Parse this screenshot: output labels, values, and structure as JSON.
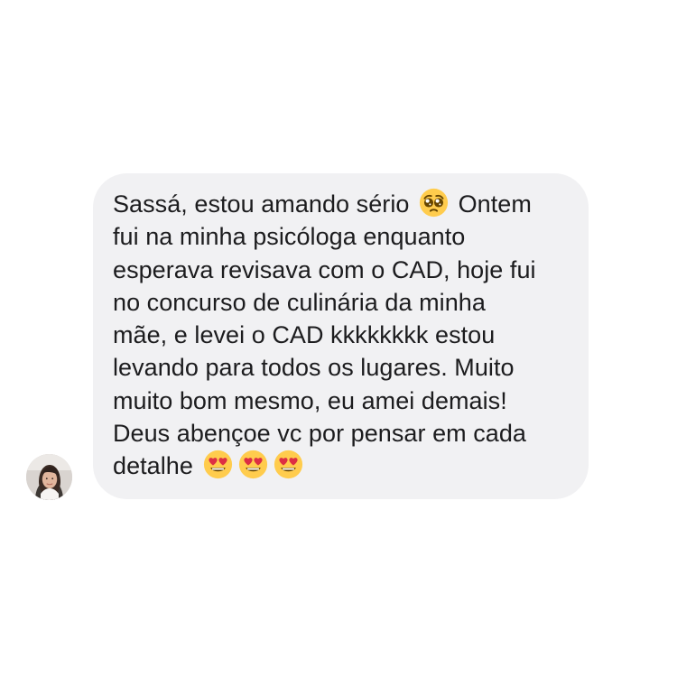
{
  "message": {
    "lines": [
      {
        "text": "Sassá, estou amando sério",
        "after": "Ontem",
        "emoji": "pleading-face-icon"
      },
      {
        "text": "fui na minha psicóloga enquanto"
      },
      {
        "text": "esperava revisava com o CAD, hoje fui"
      },
      {
        "text": "no concurso de culinária da minha"
      },
      {
        "text": "mãe, e levei o CAD kkkkkkkk estou"
      },
      {
        "text": "levando para todos os lugares. Muito"
      },
      {
        "text": "muito bom mesmo, eu amei demais!"
      },
      {
        "text": "Deus abençoe vc por pensar em cada"
      },
      {
        "text": "detalhe",
        "emojis": [
          "heart-eyes-icon",
          "heart-eyes-icon",
          "heart-eyes-icon"
        ]
      }
    ]
  },
  "sender": {
    "avatar_icon": "avatar-photo"
  },
  "colors": {
    "background": "#ffffff",
    "bubble": "#f1f1f3",
    "text": "#1c1c1e"
  }
}
